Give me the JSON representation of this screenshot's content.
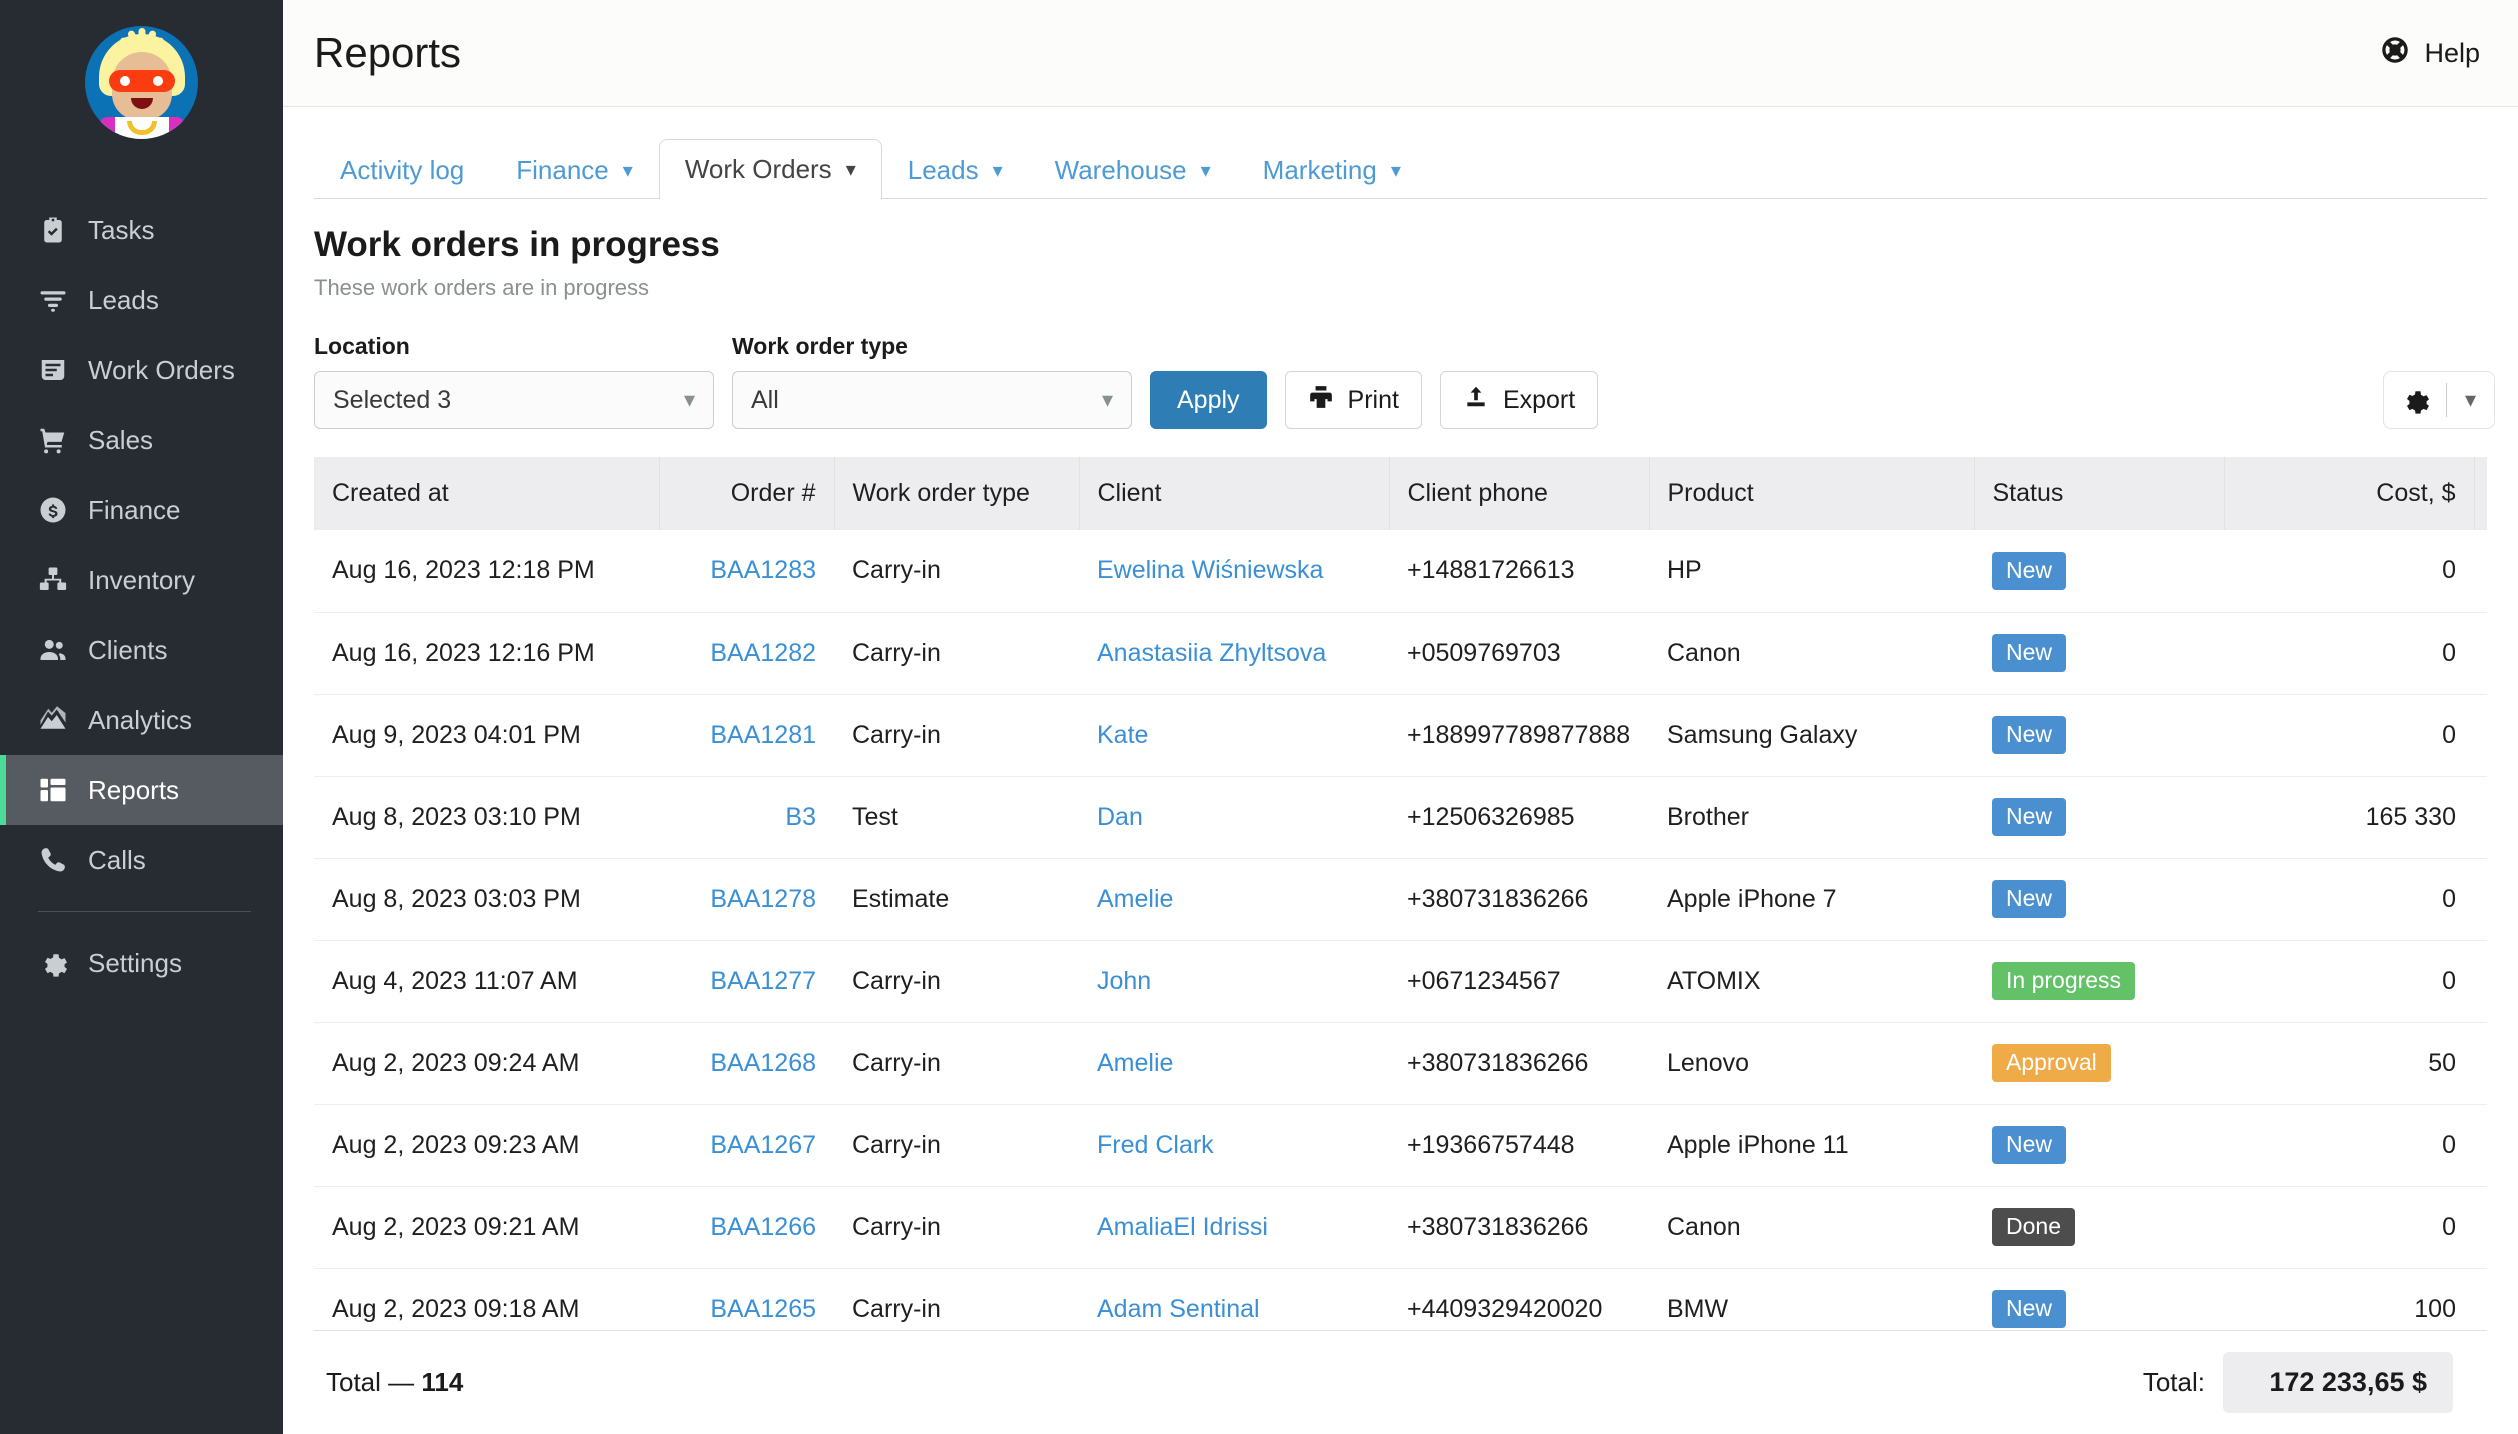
{
  "sidebar": {
    "avatar_name": "user-avatar",
    "items": [
      {
        "label": "Tasks",
        "icon": "clipboard-check-icon",
        "active": false
      },
      {
        "label": "Leads",
        "icon": "funnel-icon",
        "active": false
      },
      {
        "label": "Work Orders",
        "icon": "work-order-icon",
        "active": false
      },
      {
        "label": "Sales",
        "icon": "cart-icon",
        "active": false
      },
      {
        "label": "Finance",
        "icon": "dollar-circle-icon",
        "active": false
      },
      {
        "label": "Inventory",
        "icon": "boxes-icon",
        "active": false
      },
      {
        "label": "Clients",
        "icon": "people-icon",
        "active": false
      },
      {
        "label": "Analytics",
        "icon": "chart-area-icon",
        "active": false
      },
      {
        "label": "Reports",
        "icon": "grid-layout-icon",
        "active": true
      },
      {
        "label": "Calls",
        "icon": "phone-icon",
        "active": false
      },
      {
        "label": "Settings",
        "icon": "gear-icon",
        "active": false
      }
    ],
    "active_accent": "#4ddb9a"
  },
  "header": {
    "title": "Reports",
    "help_label": "Help",
    "help_icon": "lifebuoy-icon"
  },
  "tabs": [
    {
      "label": "Activity log",
      "has_chevron": false,
      "active": false
    },
    {
      "label": "Finance",
      "has_chevron": true,
      "active": false
    },
    {
      "label": "Work Orders",
      "has_chevron": true,
      "active": true
    },
    {
      "label": "Leads",
      "has_chevron": true,
      "active": false
    },
    {
      "label": "Warehouse",
      "has_chevron": true,
      "active": false
    },
    {
      "label": "Marketing",
      "has_chevron": true,
      "active": false
    }
  ],
  "report": {
    "title": "Work orders in progress",
    "subtitle": "These work orders are in progress"
  },
  "filters": {
    "location_label": "Location",
    "location_value": "Selected 3",
    "type_label": "Work order type",
    "type_value": "All",
    "apply_label": "Apply",
    "print_label": "Print",
    "print_icon": "printer-icon",
    "export_label": "Export",
    "export_icon": "upload-icon",
    "settings_icon": "gear-icon",
    "settings_chevron_icon": "chevron-down-icon",
    "apply_color": "#2f7db5"
  },
  "table": {
    "columns": [
      {
        "key": "created_at",
        "label": "Created at",
        "align": "left"
      },
      {
        "key": "order_no",
        "label": "Order #",
        "align": "right"
      },
      {
        "key": "type",
        "label": "Work order type",
        "align": "left"
      },
      {
        "key": "client",
        "label": "Client",
        "align": "left"
      },
      {
        "key": "phone",
        "label": "Client phone",
        "align": "left"
      },
      {
        "key": "product",
        "label": "Product",
        "align": "left"
      },
      {
        "key": "status",
        "label": "Status",
        "align": "left"
      },
      {
        "key": "cost",
        "label": "Cost, $",
        "align": "right"
      },
      {
        "key": "extra",
        "label": "",
        "align": "left"
      }
    ],
    "status_colors": {
      "New": "#4a90d0",
      "In progress": "#63c168",
      "Approval": "#efab48",
      "Done": "#4d4d4d"
    },
    "rows": [
      {
        "created_at": "Aug 16, 2023 12:18 PM",
        "order_no": "BAA1283",
        "type": "Carry-in",
        "client": "Ewelina Wiśniewska",
        "phone": "+14881726613",
        "product": "HP",
        "status": "New",
        "cost": "0"
      },
      {
        "created_at": "Aug 16, 2023 12:16 PM",
        "order_no": "BAA1282",
        "type": "Carry-in",
        "client": "Anastasiia Zhyltsova",
        "phone": "+0509769703",
        "product": "Canon",
        "status": "New",
        "cost": "0"
      },
      {
        "created_at": "Aug 9, 2023 04:01 PM",
        "order_no": "BAA1281",
        "type": "Carry-in",
        "client": "Kate",
        "phone": "+188997789877888",
        "product": "Samsung Galaxy",
        "status": "New",
        "cost": "0"
      },
      {
        "created_at": "Aug 8, 2023 03:10 PM",
        "order_no": "B3",
        "type": "Test",
        "client": "Dan",
        "phone": "+12506326985",
        "product": "Brother",
        "status": "New",
        "cost": "165 330"
      },
      {
        "created_at": "Aug 8, 2023 03:03 PM",
        "order_no": "BAA1278",
        "type": "Estimate",
        "client": "Amelie",
        "phone": "+380731836266",
        "product": "Apple iPhone 7",
        "status": "New",
        "cost": "0"
      },
      {
        "created_at": "Aug 4, 2023 11:07 AM",
        "order_no": "BAA1277",
        "type": "Carry-in",
        "client": "John",
        "phone": "+0671234567",
        "product": "ATOMIX",
        "status": "In progress",
        "cost": "0"
      },
      {
        "created_at": "Aug 2, 2023 09:24 AM",
        "order_no": "BAA1268",
        "type": "Carry-in",
        "client": "Amelie",
        "phone": "+380731836266",
        "product": "Lenovo",
        "status": "Approval",
        "cost": "50"
      },
      {
        "created_at": "Aug 2, 2023 09:23 AM",
        "order_no": "BAA1267",
        "type": "Carry-in",
        "client": "Fred Clark",
        "phone": "+19366757448",
        "product": "Apple iPhone 11",
        "status": "New",
        "cost": "0"
      },
      {
        "created_at": "Aug 2, 2023 09:21 AM",
        "order_no": "BAA1266",
        "type": "Carry-in",
        "client": "AmaliaEl Idrissi",
        "phone": "+380731836266",
        "product": "Canon",
        "status": "Done",
        "cost": "0"
      },
      {
        "created_at": "Aug 2, 2023 09:18 AM",
        "order_no": "BAA1265",
        "type": "Carry-in",
        "client": "Adam Sentinal",
        "phone": "+4409329420020",
        "product": "BMW",
        "status": "New",
        "cost": "100"
      }
    ]
  },
  "footer": {
    "total_count_label": "Total —",
    "total_count": "114",
    "total_label": "Total:",
    "total_value": "172 233,65 $"
  }
}
